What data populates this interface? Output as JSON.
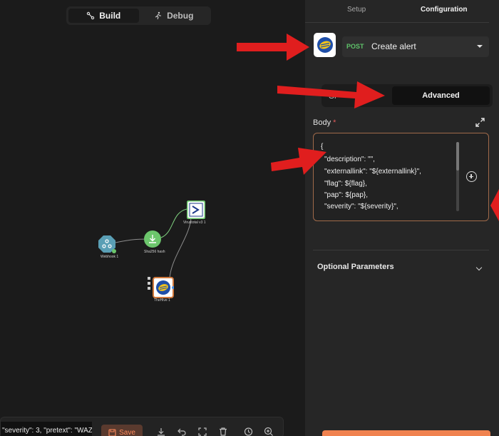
{
  "canvas": {
    "mode_toggle": {
      "build_label": "Build",
      "debug_label": "Debug",
      "active": "Build"
    },
    "nodes": [
      {
        "label": "Webhook 1",
        "icon": "webhook-icon"
      },
      {
        "label": "Sha256 hash",
        "icon": "download-icon"
      },
      {
        "label": "Virustotal v3 1",
        "icon": "sigma-icon"
      },
      {
        "label": "TheHive 1",
        "icon": "thehive-bee-icon"
      }
    ],
    "bottom_bar": {
      "json_preview": "\"severity\": 3, \"pretext\": \"WAZ",
      "save_label": "Save",
      "tools": [
        "download-icon",
        "undo-icon",
        "fullscreen-icon",
        "trash-icon",
        "history-icon",
        "zoom-in-icon"
      ]
    }
  },
  "panel": {
    "tabs": {
      "setup": "Setup",
      "configuration": "Configuration",
      "active": "Configuration"
    },
    "action": {
      "method": "POST",
      "name": "Create alert",
      "app_icon": "thehive-bee-icon"
    },
    "mode": {
      "simple": "Si",
      "advanced": "Advanced",
      "active": "Advanced"
    },
    "body": {
      "label": "Body",
      "required_mark": "*",
      "lines": [
        "{",
        "\"description\": \"\",",
        "\"externallink\": \"${externallink}\",",
        "\"flag\": ${flag},",
        "\"pap\": ${pap},",
        "\"severity\": \"${severity}\","
      ]
    },
    "optional_parameters_label": "Optional Parameters"
  },
  "colors": {
    "accent": "#f0824f",
    "method": "#5fc36a",
    "arrow": "#e01e1e",
    "node_ok": "#6cc66c",
    "node_webhook": "#5a9fb5"
  }
}
